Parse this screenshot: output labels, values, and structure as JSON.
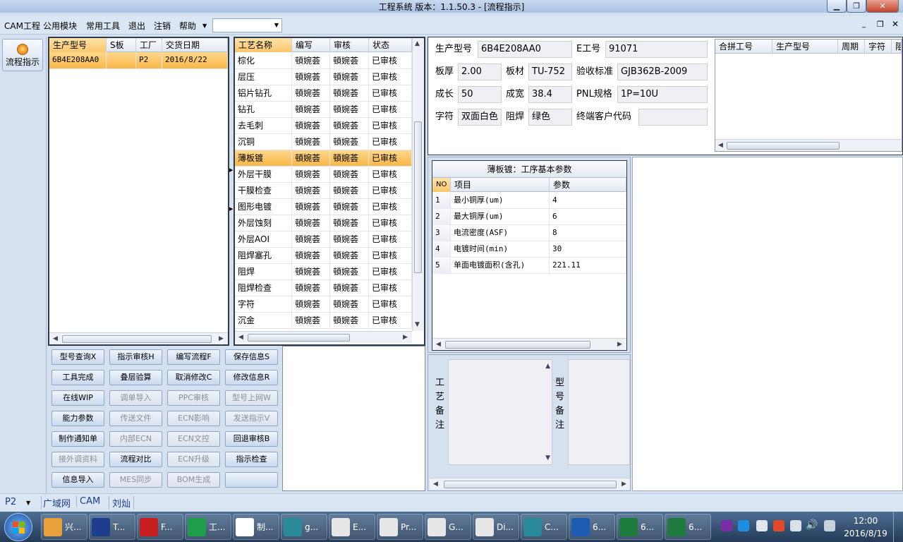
{
  "window": {
    "title": "工程系统   版本：1.1.50.3 - [流程指示]"
  },
  "menu": [
    "CAM工程",
    "公用模块",
    "常用工具",
    "退出",
    "注销",
    "帮助"
  ],
  "nav": {
    "label": "流程指示"
  },
  "models": {
    "headers": [
      "生产型号",
      "S板",
      "工厂",
      "交货日期"
    ],
    "rows": [
      [
        "6B4E208AA0",
        "",
        "P2",
        "2016/8/22"
      ]
    ]
  },
  "processes": {
    "headers": [
      "工艺名称",
      "编写",
      "审核",
      "状态"
    ],
    "rows": [
      [
        "棕化",
        "頓婉荟",
        "頓婉荟",
        "已审核"
      ],
      [
        "层压",
        "頓婉荟",
        "頓婉荟",
        "已审核"
      ],
      [
        "铝片钻孔",
        "頓婉荟",
        "頓婉荟",
        "已审核"
      ],
      [
        "钻孔",
        "頓婉荟",
        "頓婉荟",
        "已审核"
      ],
      [
        "去毛刺",
        "頓婉荟",
        "頓婉荟",
        "已审核"
      ],
      [
        "沉铜",
        "頓婉荟",
        "頓婉荟",
        "已审核"
      ],
      [
        "薄板镀",
        "頓婉荟",
        "頓婉荟",
        "已审核"
      ],
      [
        "外层干膜",
        "頓婉荟",
        "頓婉荟",
        "已审核"
      ],
      [
        "干膜检查",
        "頓婉荟",
        "頓婉荟",
        "已审核"
      ],
      [
        "图形电镀",
        "頓婉荟",
        "頓婉荟",
        "已审核"
      ],
      [
        "外层蚀刻",
        "頓婉荟",
        "頓婉荟",
        "已审核"
      ],
      [
        "外层AOI",
        "頓婉荟",
        "頓婉荟",
        "已审核"
      ],
      [
        "阻焊塞孔",
        "頓婉荟",
        "頓婉荟",
        "已审核"
      ],
      [
        "阻焊",
        "頓婉荟",
        "頓婉荟",
        "已审核"
      ],
      [
        "阻焊检查",
        "頓婉荟",
        "頓婉荟",
        "已审核"
      ],
      [
        "字符",
        "頓婉荟",
        "頓婉荟",
        "已审核"
      ],
      [
        "沉金",
        "頓婉荟",
        "頓婉荟",
        "已审核"
      ]
    ],
    "selected_index": 6
  },
  "buttons": [
    {
      "label": "型号查询X",
      "enabled": true
    },
    {
      "label": "指示审核H",
      "enabled": true
    },
    {
      "label": "编写流程F",
      "enabled": true
    },
    {
      "label": "保存信息S",
      "enabled": true
    },
    {
      "label": "工具完成",
      "enabled": true
    },
    {
      "label": "叠层验算",
      "enabled": true
    },
    {
      "label": "取消修改C",
      "enabled": true
    },
    {
      "label": "修改信息R",
      "enabled": true
    },
    {
      "label": "在线WIP",
      "enabled": true
    },
    {
      "label": "调单导入",
      "enabled": false
    },
    {
      "label": "PPC审核",
      "enabled": false
    },
    {
      "label": "型号上网W",
      "enabled": false
    },
    {
      "label": "能力参数",
      "enabled": true
    },
    {
      "label": "传送文件",
      "enabled": false
    },
    {
      "label": "ECN影响",
      "enabled": false
    },
    {
      "label": "发送指示V",
      "enabled": false
    },
    {
      "label": "制作通知单",
      "enabled": true
    },
    {
      "label": "内部ECN",
      "enabled": false
    },
    {
      "label": "ECN文控",
      "enabled": false
    },
    {
      "label": "回退审核B",
      "enabled": true
    },
    {
      "label": "接外调资料",
      "enabled": false
    },
    {
      "label": "流程对比",
      "enabled": true
    },
    {
      "label": "ECN升级",
      "enabled": false
    },
    {
      "label": "指示检查",
      "enabled": true
    },
    {
      "label": "信息导入",
      "enabled": true
    },
    {
      "label": "MES同步",
      "enabled": false
    },
    {
      "label": "BOM生成",
      "enabled": false
    },
    {
      "label": "",
      "enabled": true
    }
  ],
  "info": {
    "model_label": "生产型号",
    "model": "6B4E208AA0",
    "eno_label": "E工号",
    "eno": "91071",
    "thick_label": "板厚",
    "thick": "2.00",
    "material_label": "板材",
    "material": "TU-752",
    "std_label": "验收标准",
    "std": "GJB362B-2009",
    "len_label": "成长",
    "len": "50",
    "width_label": "成宽",
    "width": "38.4",
    "pnl_label": "PNL规格",
    "pnl": "1P=10U",
    "char_label": "字符",
    "char": "双面白色",
    "mask_label": "阻焊",
    "mask": "绿色",
    "cust_label": "终端客户代码",
    "cust": ""
  },
  "merge": {
    "headers": [
      "合拼工号",
      "生产型号",
      "周期",
      "字符",
      "阻"
    ]
  },
  "params": {
    "title": "薄板镀：工序基本参数",
    "headers": [
      "NO",
      "项目",
      "参数"
    ],
    "rows": [
      [
        "1",
        "最小铜厚(um)",
        "4"
      ],
      [
        "2",
        "最大铜厚(um)",
        "6"
      ],
      [
        "3",
        "电流密度(ASF)",
        "8"
      ],
      [
        "4",
        "电镀时间(min)",
        "30"
      ],
      [
        "5",
        "单面电镀面积(含孔)",
        "221.11"
      ]
    ]
  },
  "notes": {
    "process_label": "工艺备注",
    "model_label": "型号备注"
  },
  "status": {
    "factory": "P2",
    "items": [
      "广域网",
      "CAM",
      "刘灿"
    ]
  },
  "taskbar": {
    "items": [
      "兴...",
      "T...",
      "F...",
      "工...",
      "制...",
      "g...",
      "E...",
      "Pr...",
      "G...",
      "Di...",
      "C...",
      "6...",
      "6...",
      "6..."
    ],
    "time": "12:00",
    "date": "2016/8/19"
  }
}
